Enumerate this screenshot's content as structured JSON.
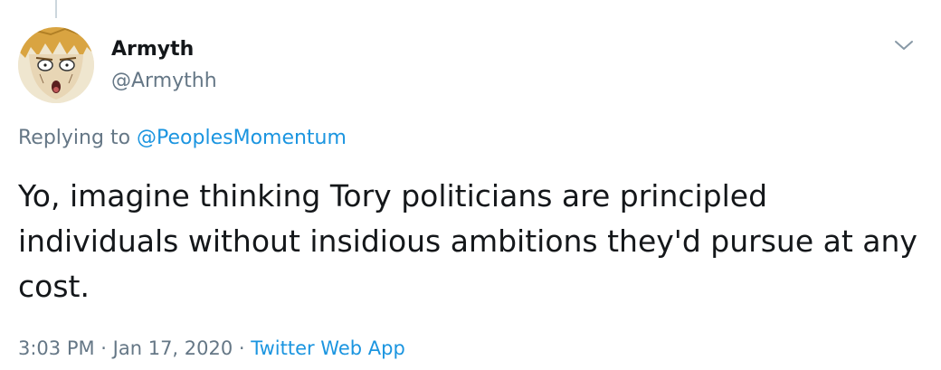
{
  "author": {
    "display_name": "Armyth",
    "handle": "@Armythh"
  },
  "reply": {
    "prefix": "Replying to ",
    "mention": "@PeoplesMomentum"
  },
  "tweet": {
    "text": "Yo, imagine thinking Tory politicians are principled individuals without insidious ambitions they'd pursue at any cost."
  },
  "meta": {
    "time": "3:03 PM",
    "sep1": " · ",
    "date": "Jan 17, 2020",
    "sep2": " · ",
    "source": "Twitter Web App"
  },
  "icons": {
    "menu": "chevron-down-icon",
    "avatar": "anime-face-avatar"
  },
  "colors": {
    "text_primary": "#14171a",
    "text_secondary": "#657786",
    "link": "#1b95e0",
    "thread_line": "#ccd6dd"
  }
}
